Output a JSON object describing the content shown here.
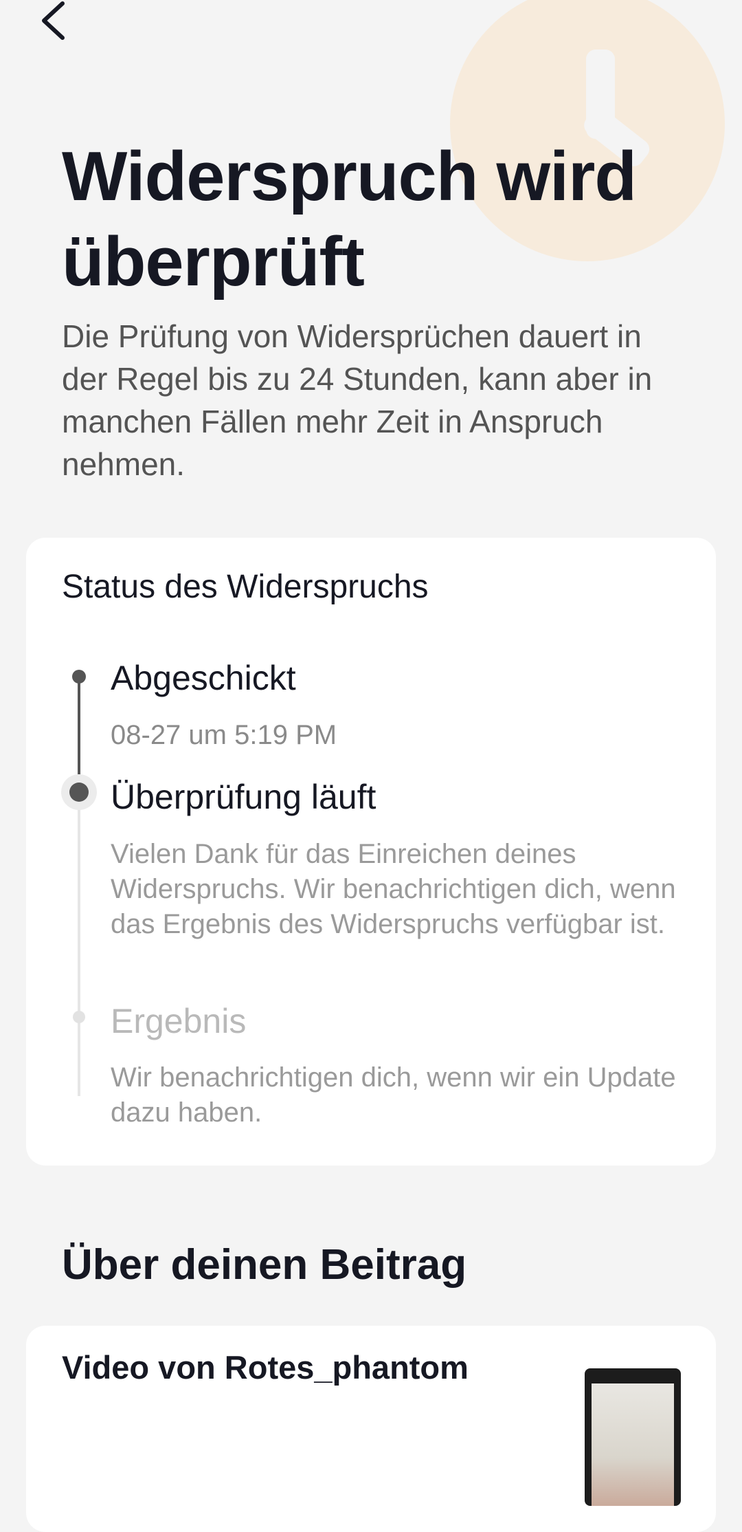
{
  "header": {
    "title": "Widerspruch wird überprüft",
    "subtitle": "Die Prüfung von Widersprüchen dauert in der Regel bis zu 24 Stunden, kann aber in manchen Fällen mehr Zeit in Anspruch nehmen."
  },
  "status_card": {
    "title": "Status des Widerspruchs",
    "steps": [
      {
        "title": "Abgeschickt",
        "text": "08-27 um 5:19 PM"
      },
      {
        "title": "Überprüfung läuft",
        "text": "Vielen Dank für das Einreichen deines Widerspruchs. Wir benachrichtigen dich, wenn das Ergebnis des Widerspruchs verfügbar ist."
      },
      {
        "title": "Ergebnis",
        "text": "Wir benachrichtigen dich, wenn wir ein Update dazu haben."
      }
    ]
  },
  "post_section": {
    "title": "Über deinen Beitrag",
    "post_title": "Video von Rotes_phantom"
  },
  "icons": {
    "back": "chevron-left-icon",
    "decoration": "clock-icon"
  },
  "colors": {
    "background": "#f4f4f4",
    "card": "#ffffff",
    "text_primary": "#161823",
    "text_secondary": "#545454",
    "text_muted": "#9a9a9a",
    "step_done": "#555555",
    "step_pending": "#e2e2e2",
    "clock_accent": "#f7ebdc"
  }
}
